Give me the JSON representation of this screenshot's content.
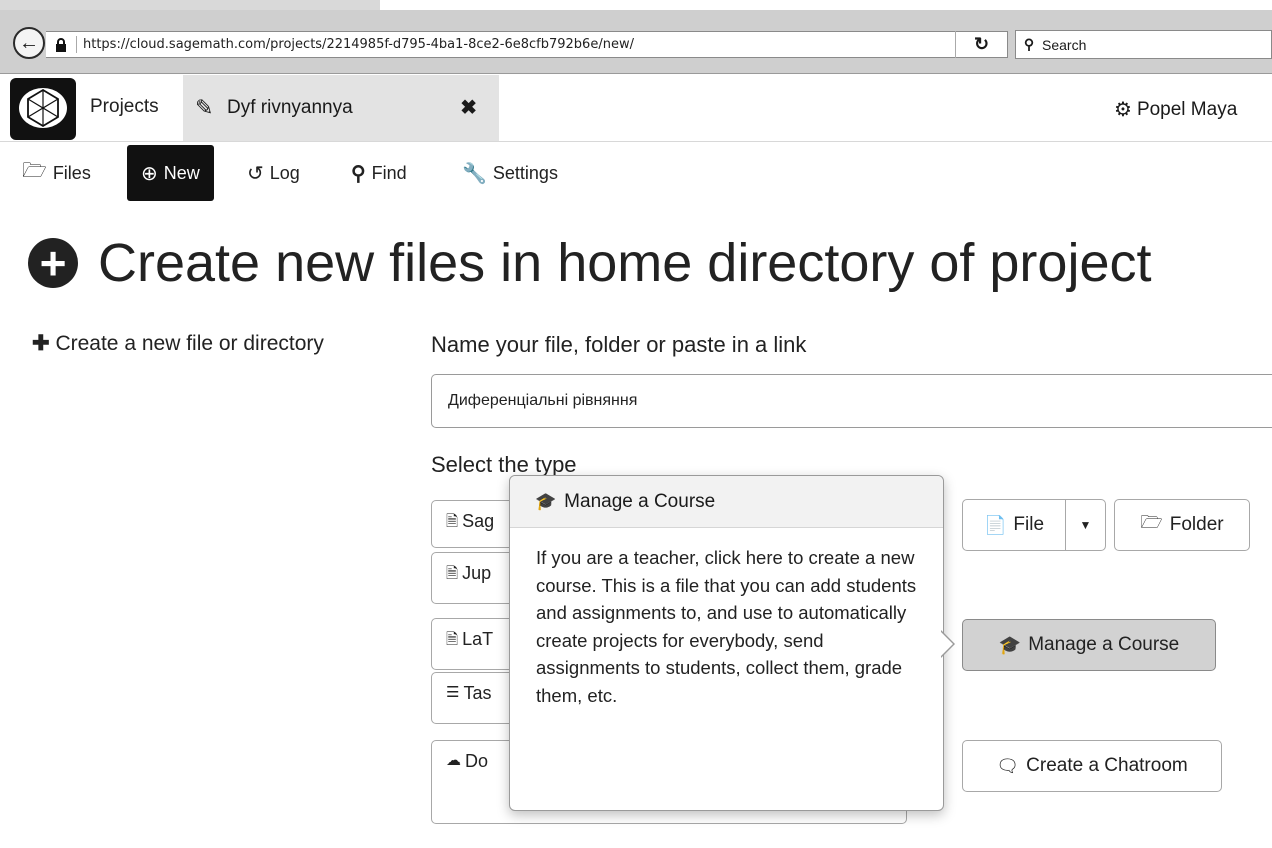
{
  "browser": {
    "url": "https://cloud.sagemath.com/projects/2214985f-d795-4ba1-8ce2-6e8cfb792b6e/new/",
    "search_placeholder": "Search"
  },
  "appnav": {
    "projects_label": "Projects",
    "tab_label": "Dyf rivnyannya",
    "user_label": "Popel Maya"
  },
  "subnav": {
    "files": "Files",
    "new": "New",
    "log": "Log",
    "find": "Find",
    "settings": "Settings"
  },
  "page": {
    "title": "Create new files in home directory of project",
    "left_label": "Create a new file or directory",
    "name_label": "Name your file, folder or paste in a link",
    "name_value": "Диференціальні рівняння",
    "type_label": "Select the type"
  },
  "type_buttons": {
    "sage": "Sag",
    "jupyter": "Jup",
    "latex": "LaT",
    "task": "Tas",
    "download": "Do"
  },
  "actions": {
    "file": "File",
    "folder": "Folder",
    "manage_course": "Manage a Course",
    "chatroom": "Create a Chatroom"
  },
  "popover": {
    "title": "Manage a Course",
    "body": "If you are a teacher, click here to create a new course. This is a file that you can add students and assignments to, and use to automatically create projects for everybody, send assignments to students, collect them, grade them, etc."
  }
}
